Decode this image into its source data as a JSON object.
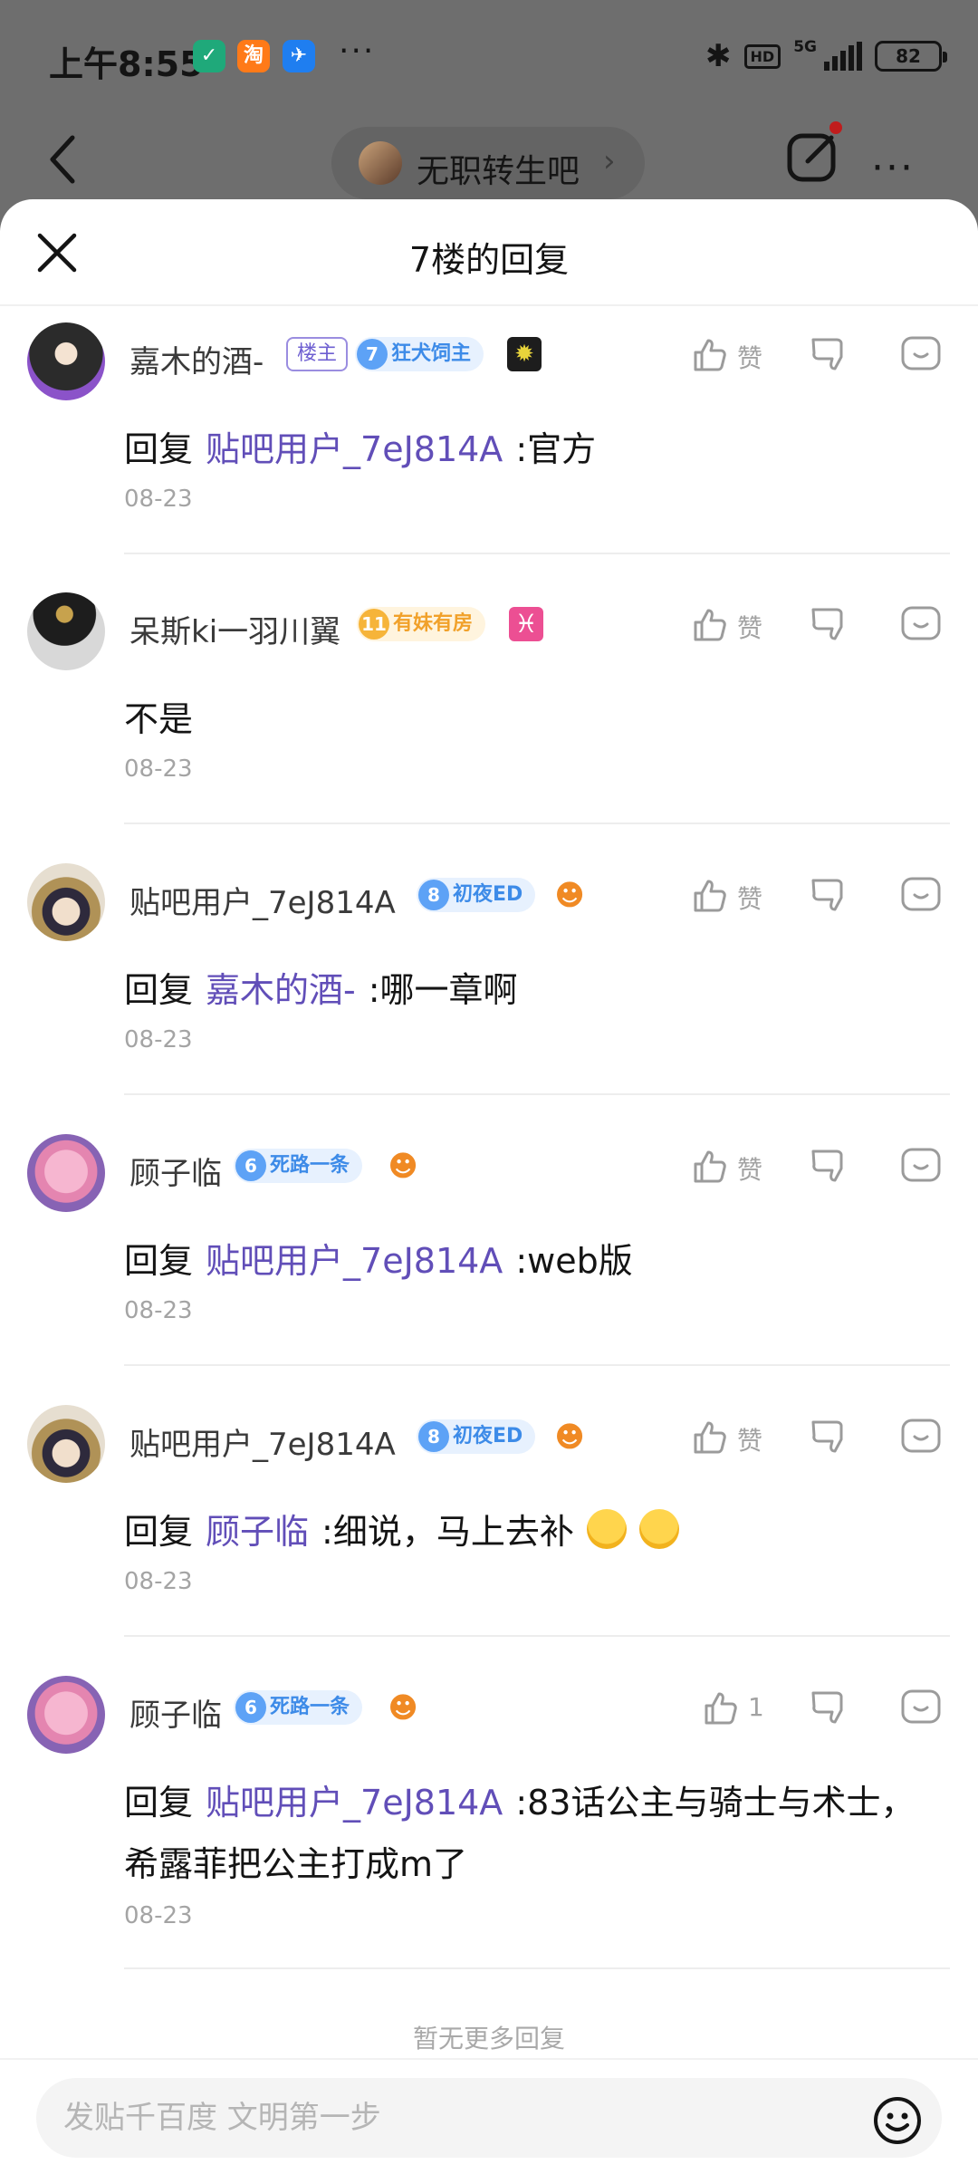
{
  "status_bar": {
    "time": "上午8:55",
    "network": "5G",
    "hd": "HD",
    "battery": "82"
  },
  "header": {
    "forum_name": "无职转生吧"
  },
  "sheet": {
    "title": "7楼的回复"
  },
  "replies": [
    {
      "user": "嘉木的酒-",
      "owner_badge": "楼主",
      "level": "7",
      "level_title": "狂犬饲主",
      "level_color": "blue",
      "like_label": "赞",
      "reply_prefix": "回复",
      "reply_to": "贴吧用户_7eJ814A",
      "text": ":官方",
      "date": "08-23"
    },
    {
      "user": "呆斯ki一羽川翼",
      "level": "11",
      "level_title": "有妹有房",
      "level_color": "gold",
      "like_label": "赞",
      "text": "不是",
      "date": "08-23"
    },
    {
      "user": "贴吧用户_7eJ814A",
      "level": "8",
      "level_title": "初夜ED",
      "level_color": "blue",
      "like_label": "赞",
      "reply_prefix": "回复",
      "reply_to": "嘉木的酒-",
      "text": ":哪一章啊",
      "date": "08-23"
    },
    {
      "user": "顾子临",
      "level": "6",
      "level_title": "死路一条",
      "level_color": "blue",
      "like_label": "赞",
      "reply_prefix": "回复",
      "reply_to": "贴吧用户_7eJ814A",
      "text": ":web版",
      "date": "08-23"
    },
    {
      "user": "贴吧用户_7eJ814A",
      "level": "8",
      "level_title": "初夜ED",
      "level_color": "blue",
      "like_label": "赞",
      "reply_prefix": "回复",
      "reply_to": "顾子临",
      "text": ":细说，马上去补",
      "date": "08-23"
    },
    {
      "user": "顾子临",
      "level": "6",
      "level_title": "死路一条",
      "level_color": "blue",
      "like_label": "1",
      "reply_prefix": "回复",
      "reply_to": "贴吧用户_7eJ814A",
      "text": ":83话公主与骑士与术士，",
      "text2": "希露菲把公主打成m了",
      "date": "08-23"
    }
  ],
  "footer": {
    "no_more": "暂无更多回复",
    "input_placeholder": "发贴千百度 文明第一步"
  },
  "colors": {
    "link": "#614eb8",
    "level_blue": "#3d8be8",
    "level_gold": "#f1a12a"
  }
}
